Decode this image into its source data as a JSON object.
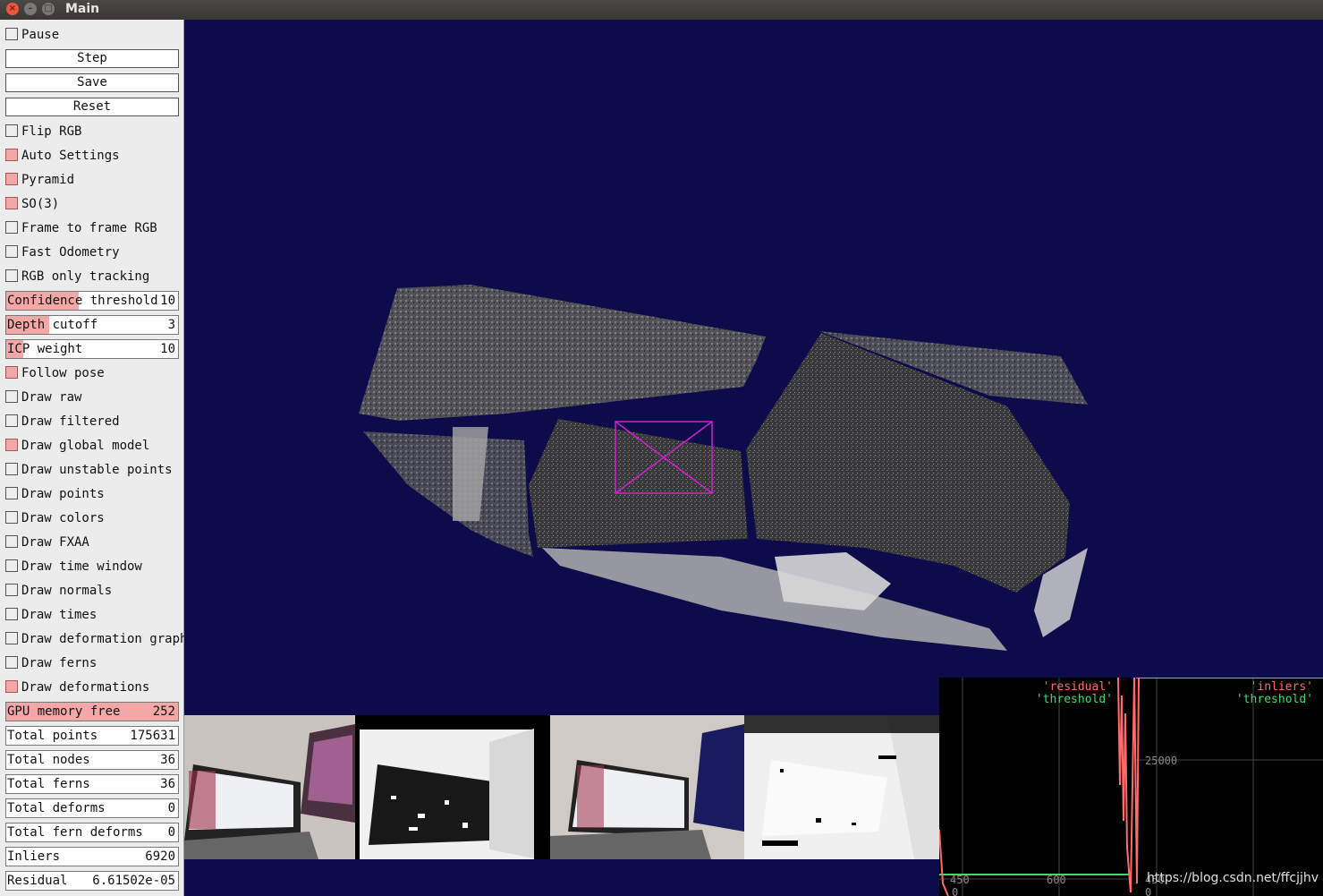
{
  "window": {
    "title": "Main"
  },
  "panel": {
    "pause": {
      "label": "Pause",
      "checked": false
    },
    "buttons": {
      "step": "Step",
      "save": "Save",
      "reset": "Reset"
    },
    "options": [
      {
        "label": "Flip RGB",
        "checked": false
      },
      {
        "label": "Auto Settings",
        "checked": true
      },
      {
        "label": "Pyramid",
        "checked": true
      },
      {
        "label": "SO(3)",
        "checked": true
      },
      {
        "label": "Frame to frame RGB",
        "checked": false
      },
      {
        "label": "Fast Odometry",
        "checked": false
      },
      {
        "label": "RGB only tracking",
        "checked": false
      }
    ],
    "sliders": [
      {
        "label": "Confidence threshold",
        "value": "10",
        "fill": 0.42
      },
      {
        "label": "Depth cutoff",
        "value": "3",
        "fill": 0.25
      },
      {
        "label": "ICP weight",
        "value": "10",
        "fill": 0.1
      }
    ],
    "draw_options": [
      {
        "label": "Follow pose",
        "checked": true
      },
      {
        "label": "Draw raw",
        "checked": false
      },
      {
        "label": "Draw filtered",
        "checked": false
      },
      {
        "label": "Draw global model",
        "checked": true
      },
      {
        "label": "Draw unstable points",
        "checked": false
      },
      {
        "label": "Draw points",
        "checked": false
      },
      {
        "label": "Draw colors",
        "checked": false
      },
      {
        "label": "Draw FXAA",
        "checked": false
      },
      {
        "label": "Draw time window",
        "checked": false
      },
      {
        "label": "Draw normals",
        "checked": false
      },
      {
        "label": "Draw times",
        "checked": false
      },
      {
        "label": "Draw deformation graph",
        "checked": false
      },
      {
        "label": "Draw ferns",
        "checked": false
      },
      {
        "label": "Draw deformations",
        "checked": true
      }
    ],
    "stats": [
      {
        "label": "GPU memory free",
        "value": "252",
        "highlight": true
      },
      {
        "label": "Total points",
        "value": "175631",
        "highlight": false
      },
      {
        "label": "Total nodes",
        "value": "36",
        "highlight": false
      },
      {
        "label": "Total ferns",
        "value": "36",
        "highlight": false
      },
      {
        "label": "Total deforms",
        "value": "0",
        "highlight": false
      },
      {
        "label": "Total fern deforms",
        "value": "0",
        "highlight": false
      },
      {
        "label": "Inliers",
        "value": "6920",
        "highlight": false
      },
      {
        "label": "Residual",
        "value": "6.61502e-05",
        "highlight": false
      }
    ]
  },
  "graphs": {
    "left": {
      "legend": [
        "'residual'",
        "'threshold'"
      ],
      "x_ticks": [
        "450",
        "600"
      ],
      "y_ticks": [
        "0"
      ]
    },
    "right": {
      "legend": [
        "'inliers'",
        "'threshold'"
      ],
      "y_ticks": [
        "25000",
        "0"
      ],
      "x_ticks": [
        "450"
      ]
    }
  },
  "watermark": "https://blog.csdn.net/ffcjjhv",
  "colors": {
    "checked": "#f4a7a7",
    "background": "#0d0b4a",
    "residual": "#ff6a6a",
    "threshold": "#3ddc6a"
  }
}
